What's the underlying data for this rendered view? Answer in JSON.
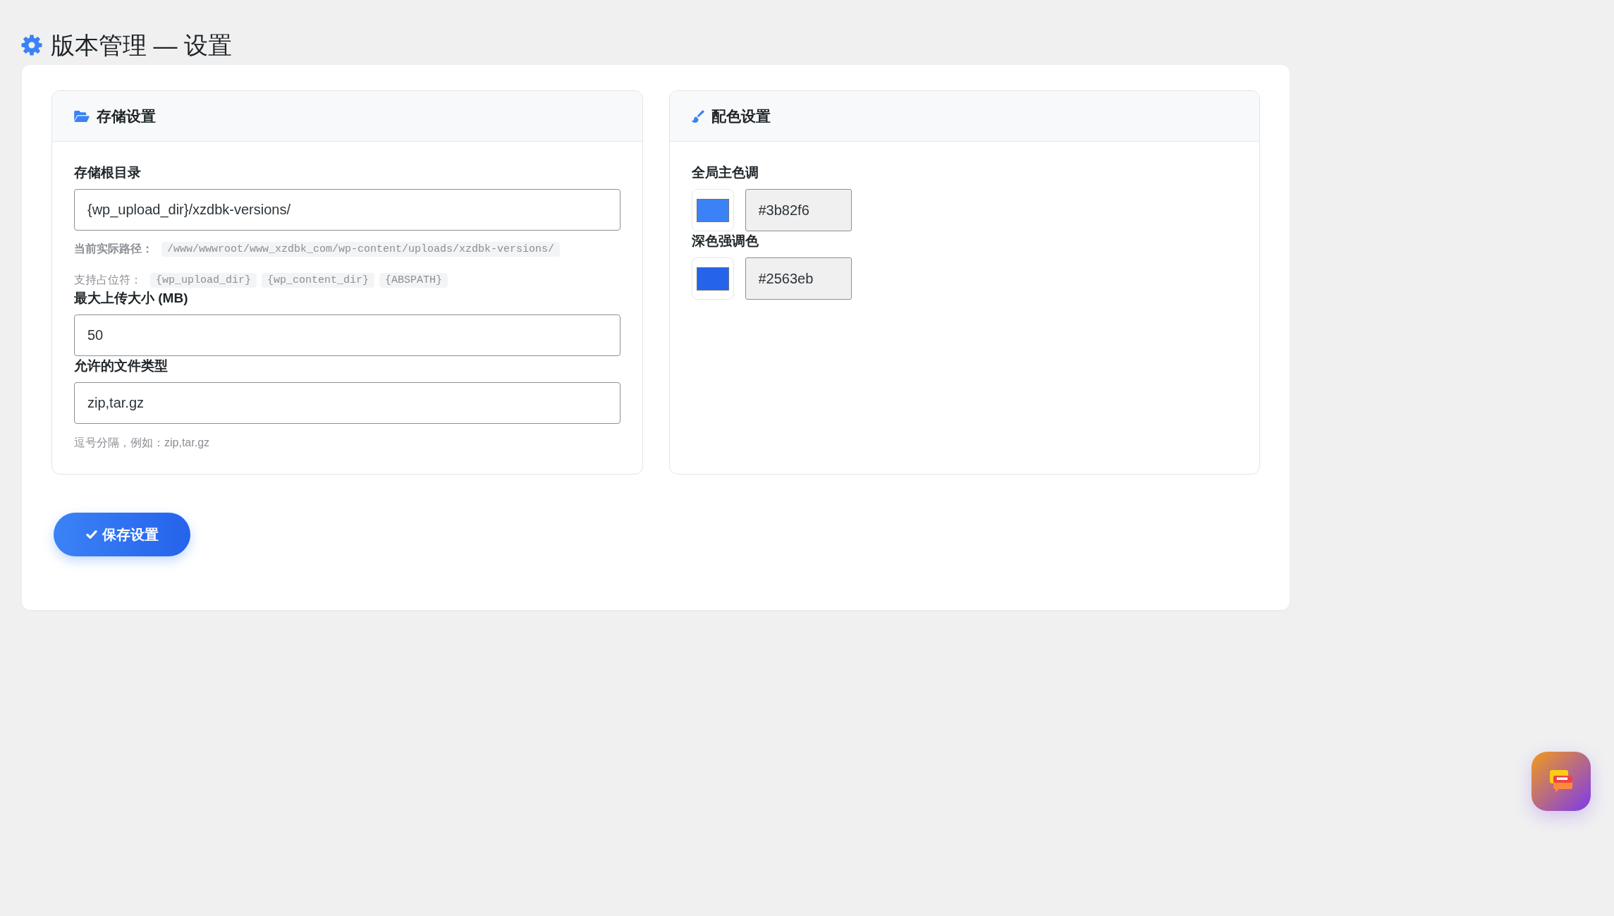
{
  "page_title": "版本管理 — 设置",
  "panels": [
    {
      "kind": "storage",
      "title": "存储设置",
      "fields": [
        {
          "kind": "text",
          "label": "存储根目录",
          "value": "{wp_upload_dir}/xzdbk-versions/",
          "notes": [
            {
              "kind": "path",
              "label": "当前实际路径：",
              "codes": [
                "/www/wwwroot/www_xzdbk_com/wp-content/uploads/xzdbk-versions/"
              ]
            },
            {
              "kind": "placeholders",
              "label": "支持占位符：",
              "codes": [
                "{wp_upload_dir}",
                "{wp_content_dir}",
                "{ABSPATH}"
              ]
            }
          ]
        },
        {
          "kind": "text",
          "label": "最大上传大小 (MB)",
          "value": "50"
        },
        {
          "kind": "text",
          "label": "允许的文件类型",
          "value": "zip,tar.gz",
          "hint": "逗号分隔，例如：zip,tar.gz"
        }
      ]
    },
    {
      "kind": "colors",
      "title": "配色设置",
      "fields": [
        {
          "kind": "color",
          "label": "全局主色调",
          "color": "#3b82f6",
          "value": "#3b82f6"
        },
        {
          "kind": "color",
          "label": "深色强调色",
          "color": "#2563eb",
          "value": "#2563eb"
        }
      ]
    }
  ],
  "save_button": {
    "label": "保存设置"
  }
}
